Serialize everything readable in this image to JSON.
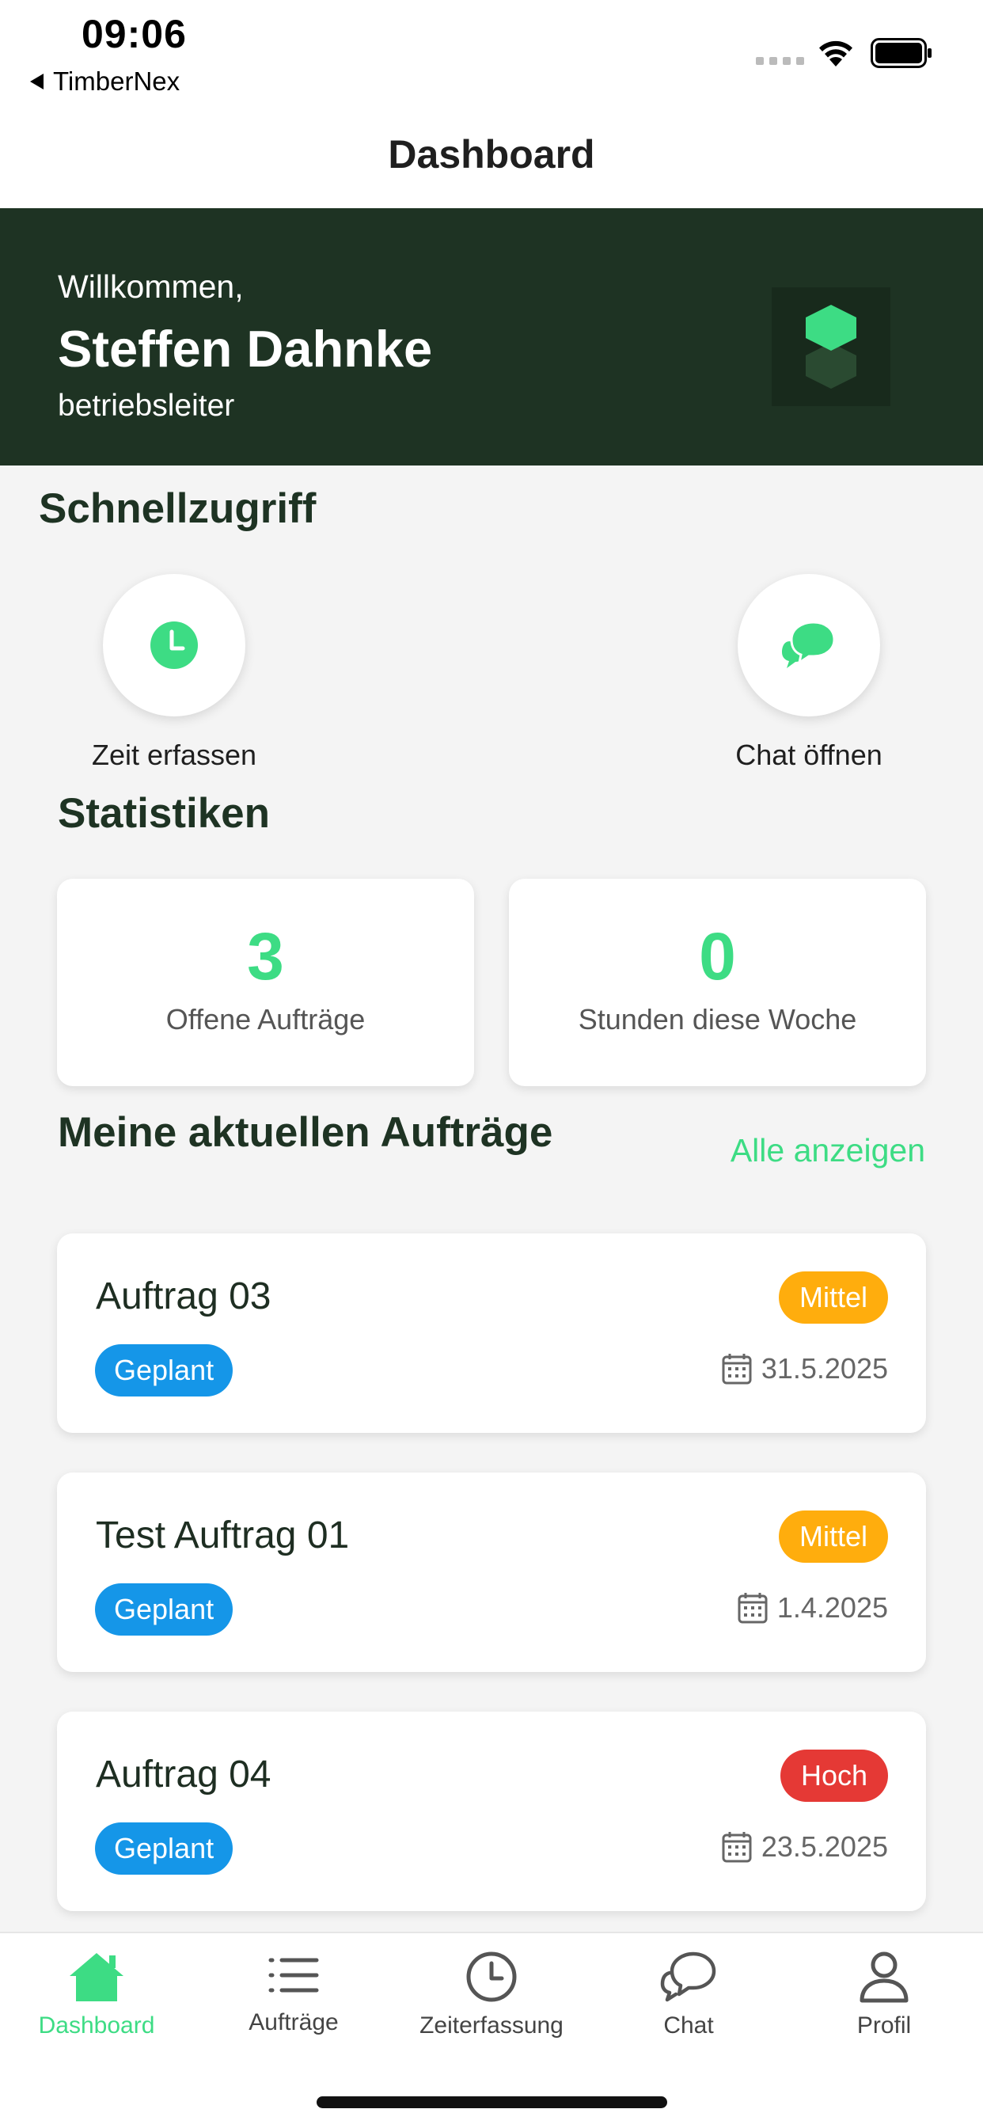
{
  "status_bar": {
    "time": "09:06",
    "back_app": "TimberNex"
  },
  "nav": {
    "title": "Dashboard"
  },
  "hero": {
    "welcome": "Willkommen,",
    "name": "Steffen Dahnke",
    "role": "betriebsleiter"
  },
  "quick_access": {
    "title": "Schnellzugriff",
    "items": [
      {
        "label": "Zeit erfassen",
        "icon": "clock-icon"
      },
      {
        "label": "Chat öffnen",
        "icon": "chat-bubbles-icon"
      }
    ]
  },
  "statistics": {
    "title": "Statistiken",
    "cards": [
      {
        "value": "3",
        "label": "Offene Aufträge"
      },
      {
        "value": "0",
        "label": "Stunden diese Woche"
      }
    ]
  },
  "orders": {
    "title": "Meine aktuellen Aufträge",
    "show_all": "Alle anzeigen",
    "items": [
      {
        "title": "Auftrag 03",
        "priority": "Mittel",
        "status": "Geplant",
        "date": "31.5.2025"
      },
      {
        "title": "Test Auftrag 01",
        "priority": "Mittel",
        "status": "Geplant",
        "date": "1.4.2025"
      },
      {
        "title": "Auftrag 04",
        "priority": "Hoch",
        "status": "Geplant",
        "date": "23.5.2025"
      }
    ]
  },
  "tabbar": {
    "items": [
      {
        "label": "Dashboard",
        "icon": "home-icon"
      },
      {
        "label": "Aufträge",
        "icon": "list-icon"
      },
      {
        "label": "Zeiterfassung",
        "icon": "clock-icon"
      },
      {
        "label": "Chat",
        "icon": "chat-icon"
      },
      {
        "label": "Profil",
        "icon": "person-icon"
      }
    ]
  },
  "colors": {
    "accent": "#3ddc84",
    "hero_bg": "#1e3323",
    "status_blue": "#1596e8",
    "priority_medium": "#ffad0d",
    "priority_high": "#e53935"
  }
}
